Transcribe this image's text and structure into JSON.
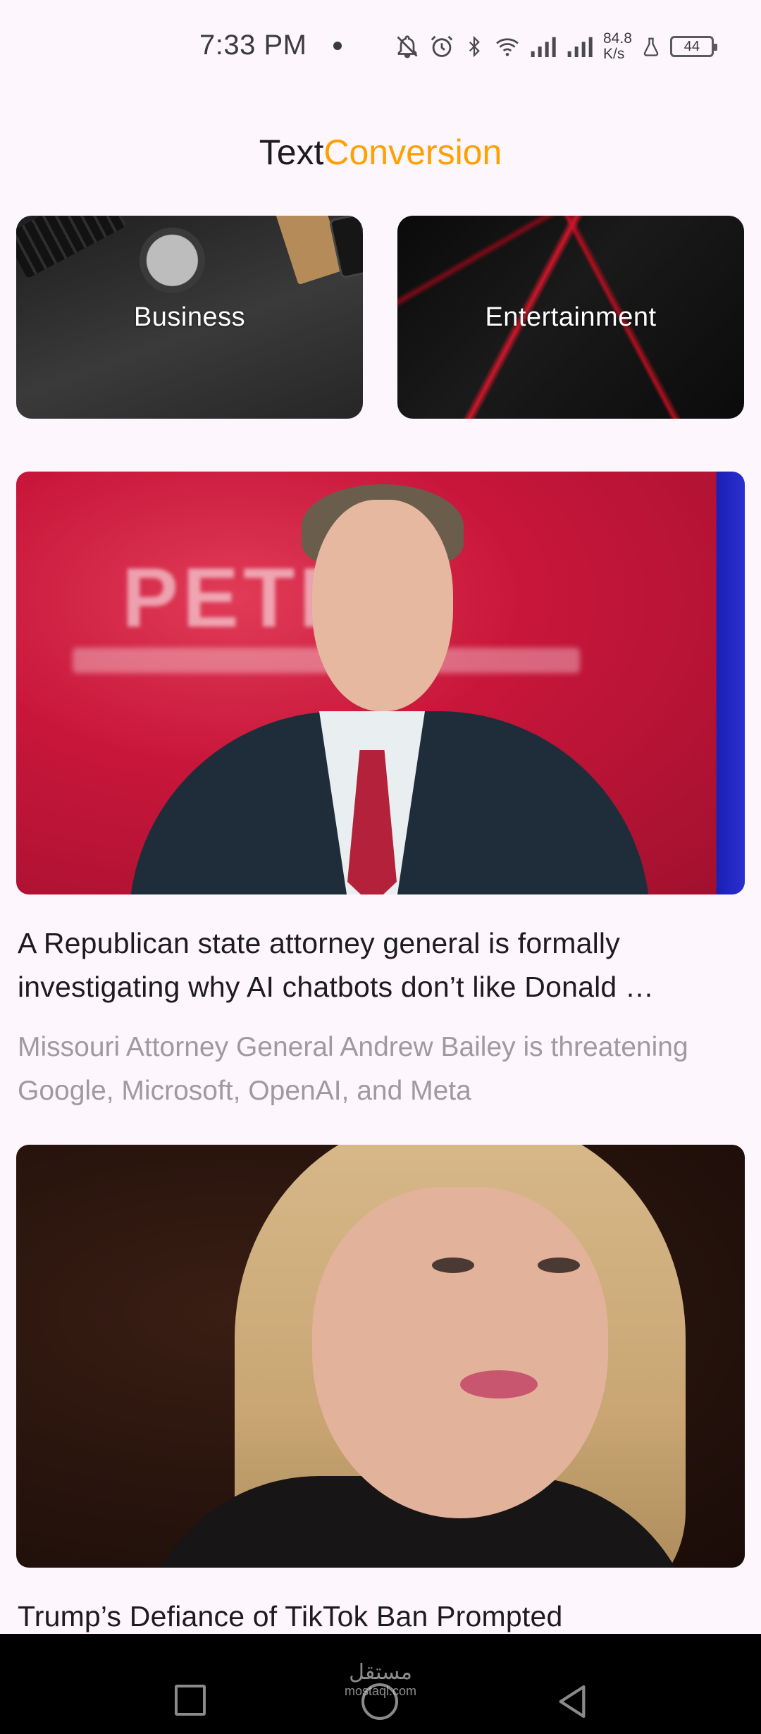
{
  "status_bar": {
    "time": "7:33 PM",
    "net_speed_value": "84.8",
    "net_speed_unit": "K/s",
    "battery": "44",
    "icons": [
      "notifications-off-icon",
      "alarm-icon",
      "bluetooth-icon",
      "wifi-icon",
      "signal-icon",
      "signal-icon",
      "lab-icon",
      "battery-icon"
    ]
  },
  "header": {
    "title_part1": "Text",
    "title_part2": "Conversion",
    "accent_color": "#ffa000"
  },
  "categories": [
    {
      "label": "Business"
    },
    {
      "label": "Entertainment"
    }
  ],
  "articles": [
    {
      "title_line1": "A Republican state attorney general is formally",
      "title_line2": "investigating why AI chatbots don’t like Donald …",
      "description": "Missouri Attorney General Andrew Bailey is threatening Google, Microsoft, OpenAI, and Meta"
    },
    {
      "title": "Trump’s Defiance of TikTok Ban Prompted"
    }
  ],
  "nav_bar": {
    "watermark_arabic": "مستقل",
    "watermark_latin": "mostaql.com"
  }
}
